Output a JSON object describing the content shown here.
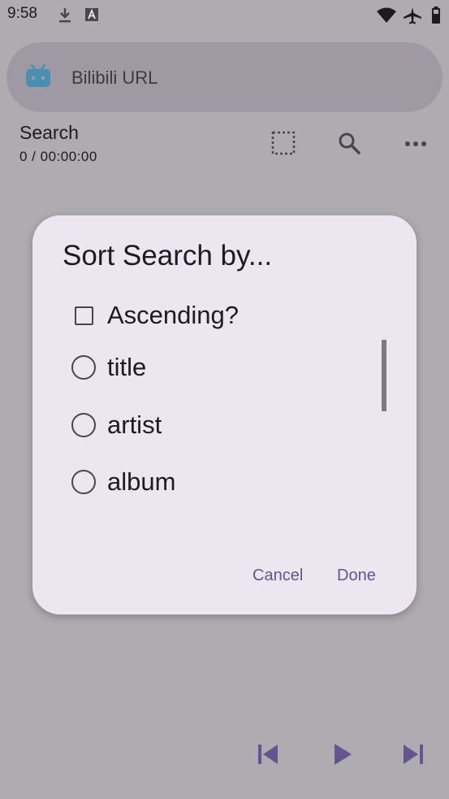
{
  "status_bar": {
    "time": "9:58",
    "left_icons": [
      "download-icon",
      "font-app-icon"
    ],
    "right_icons": [
      "wifi-icon",
      "airplane-mode-icon",
      "battery-icon"
    ]
  },
  "search_bar": {
    "icon": "tv-icon",
    "placeholder": "Bilibili URL"
  },
  "header": {
    "title": "Search",
    "subtitle": "0 / 00:00:00",
    "actions": [
      "select-icon",
      "search-icon",
      "more-icon"
    ]
  },
  "dialog": {
    "title": "Sort Search by...",
    "checkbox_label": "Ascending?",
    "checkbox_checked": false,
    "options": [
      {
        "label": "title",
        "selected": false
      },
      {
        "label": "artist",
        "selected": false
      },
      {
        "label": "album",
        "selected": false
      }
    ],
    "cancel_label": "Cancel",
    "done_label": "Done"
  },
  "player_controls": [
    "skip-previous-icon",
    "play-icon",
    "skip-next-icon"
  ],
  "colors": {
    "scrim_background": "#aeacb0",
    "dialog_surface": "#ece6f0",
    "accent": "#65558f",
    "tv_icon": "#4a8fb0"
  }
}
